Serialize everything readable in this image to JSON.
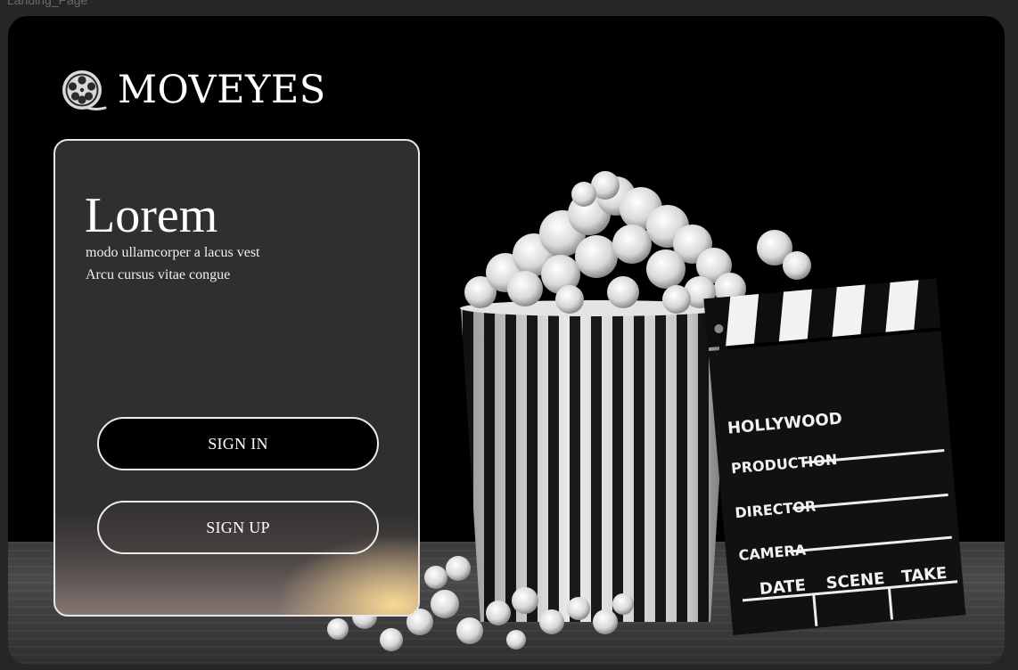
{
  "frame": {
    "label": "Landing_Page"
  },
  "brand": {
    "name": "MOVEYES",
    "icon": "film-reel-icon"
  },
  "hero": {
    "title": "Lorem",
    "line1": "modo ullamcorper a lacus vest",
    "line2": "Arcu cursus vitae congue"
  },
  "actions": {
    "sign_in": "SIGN IN",
    "sign_up": "SIGN UP"
  },
  "clapper": {
    "hollywood": "HOLLYWOOD",
    "production": "PRODUCTION",
    "director": "DIRECTOR",
    "camera": "CAMERA",
    "date": "DATE",
    "scene": "SCENE",
    "take": "TAKE"
  }
}
